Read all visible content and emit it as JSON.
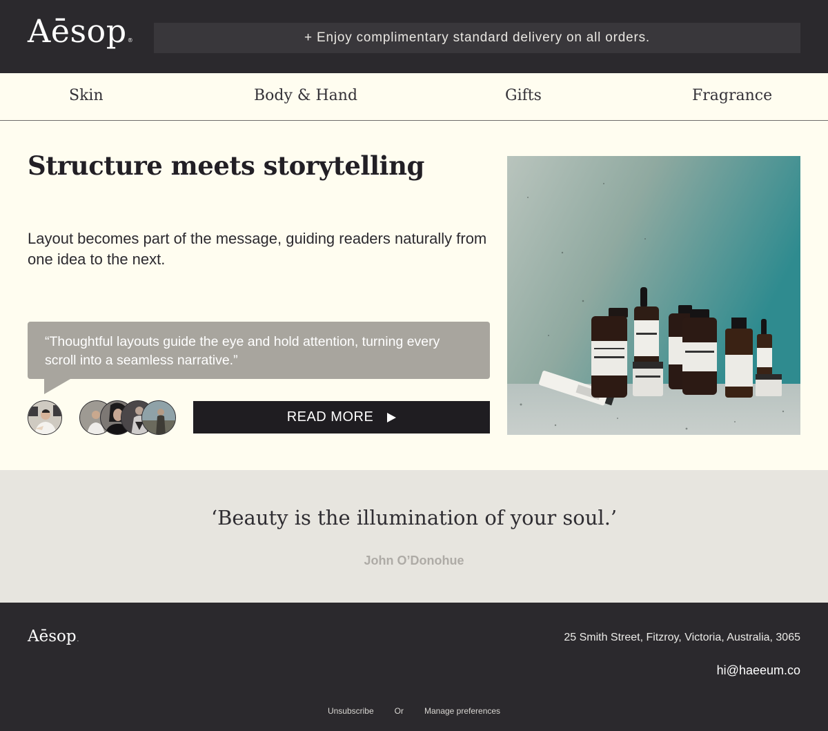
{
  "header": {
    "logo": "Aēsop",
    "logo_mark": "®",
    "promo": "+ Enjoy complimentary standard delivery on all orders."
  },
  "nav": {
    "items": [
      {
        "label": "Skin"
      },
      {
        "label": "Body & Hand"
      },
      {
        "label": "Gifts"
      },
      {
        "label": "Fragrance"
      }
    ]
  },
  "hero": {
    "title": "Structure meets storytelling",
    "description": "Layout becomes part of the message, guiding readers naturally from one idea to the next.",
    "quote": "“Thoughtful layouts guide the eye and hold attention, turning every scroll into a seamless narrative.”",
    "cta_label": "READ MORE",
    "image_alt": "Aesop product bottles on concrete ledge"
  },
  "quote_band": {
    "quote": "‘Beauty is the illumination of your soul.’",
    "author": "John O’Donohue"
  },
  "footer": {
    "logo": "Aēsop",
    "logo_mark": ".",
    "address": "25 Smith Street, Fitzroy, Victoria, Australia, 3065",
    "email": "hi@haeeum.co",
    "unsubscribe": "Unsubscribe",
    "or": "Or",
    "manage": "Manage preferences"
  },
  "colors": {
    "dark": "#2b292d",
    "cream": "#fffdf0",
    "bubble": "#a8a59e",
    "band": "#e7e5df"
  }
}
